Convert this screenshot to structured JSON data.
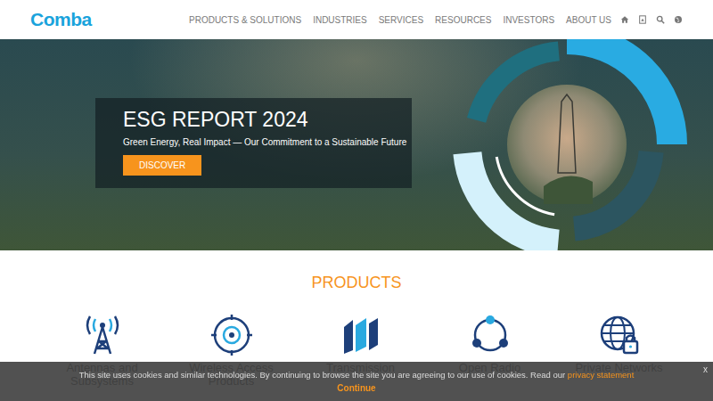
{
  "logo": "Comba",
  "nav": [
    "PRODUCTS & SOLUTIONS",
    "INDUSTRIES",
    "SERVICES",
    "RESOURCES",
    "INVESTORS",
    "ABOUT US"
  ],
  "hero": {
    "title": "ESG REPORT 2024",
    "subtitle": "Green Energy, Real Impact — Our Commitment to a Sustainable Future",
    "button": "DISCOVER"
  },
  "products": {
    "title": "PRODUCTS",
    "items": [
      {
        "label": "Antennas and Subsystems"
      },
      {
        "label": "Wireless Access Products"
      },
      {
        "label": "Transmission"
      },
      {
        "label": "Open Radio"
      },
      {
        "label": "Private Networks"
      }
    ]
  },
  "cookie": {
    "text": "This site uses cookies and similar technologies. By continuing to browse the site you are agreeing to our use of cookies. Read our",
    "link": "privacy statement",
    "button": "Continue",
    "close": "x"
  }
}
